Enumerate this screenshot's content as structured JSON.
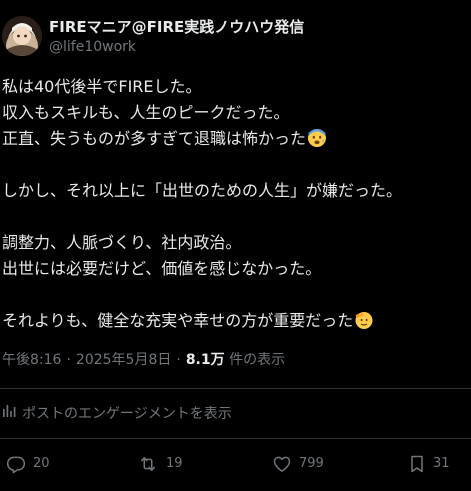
{
  "header": {
    "display_name": "FIREマニア@FIRE実践ノウハウ発信",
    "handle": "@life10work"
  },
  "post": {
    "lines": [
      "私は40代後半でFIREした。",
      "収入もスキルも、人生のピークだった。",
      "正直、失うものが多すぎて退職は怖かった",
      "",
      "しかし、それ以上に「出世のための人生」が嫌だった。",
      "",
      "調整力、人脈づくり、社内政治。",
      "出世には必要だけど、価値を感じなかった。",
      "",
      "それよりも、健全な充実や幸せの方が重要だった"
    ],
    "emoji_line3": "anxious-face-icon",
    "emoji_line10": "saluting-face-icon"
  },
  "meta": {
    "time": "午後8:16",
    "date": "2025年5月8日",
    "views_count": "8.1万",
    "views_label": "件の表示"
  },
  "engagements_link": "ポストのエンゲージメントを表示",
  "actions": {
    "replies": "20",
    "reposts": "19",
    "likes": "799",
    "bookmarks": "31"
  },
  "colors": {
    "background": "#000000",
    "text_primary": "#e7e9ea",
    "text_secondary": "#71767b",
    "divider": "#2f3336"
  }
}
